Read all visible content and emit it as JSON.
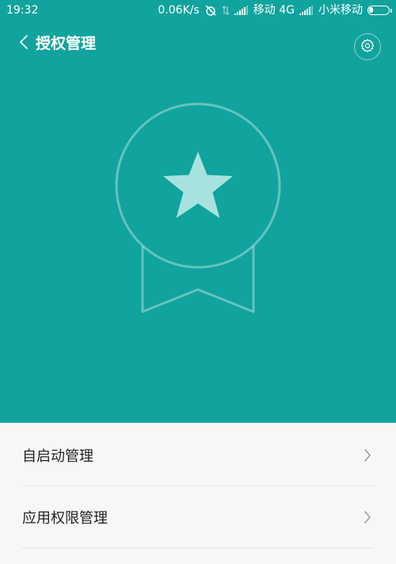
{
  "status_bar": {
    "time": "19:32",
    "speed": "0.06K/s",
    "carrier1": "移动 4G",
    "carrier2": "小米移动",
    "icons": [
      "alarm-off-icon",
      "data-arrows-icon",
      "signal-icon",
      "signal-icon",
      "battery-icon"
    ],
    "battery_level": 0.2
  },
  "header": {
    "title": "授权管理",
    "back_icon": "chevron-left-icon",
    "settings_icon": "gear-icon"
  },
  "hero": {
    "background_color": "#11a39d",
    "illustration": "badge-star-icon",
    "accent_color": "#a8e2de"
  },
  "list": {
    "items": [
      {
        "label": "自启动管理",
        "icon": "chevron-right-icon"
      },
      {
        "label": "应用权限管理",
        "icon": "chevron-right-icon"
      }
    ]
  }
}
